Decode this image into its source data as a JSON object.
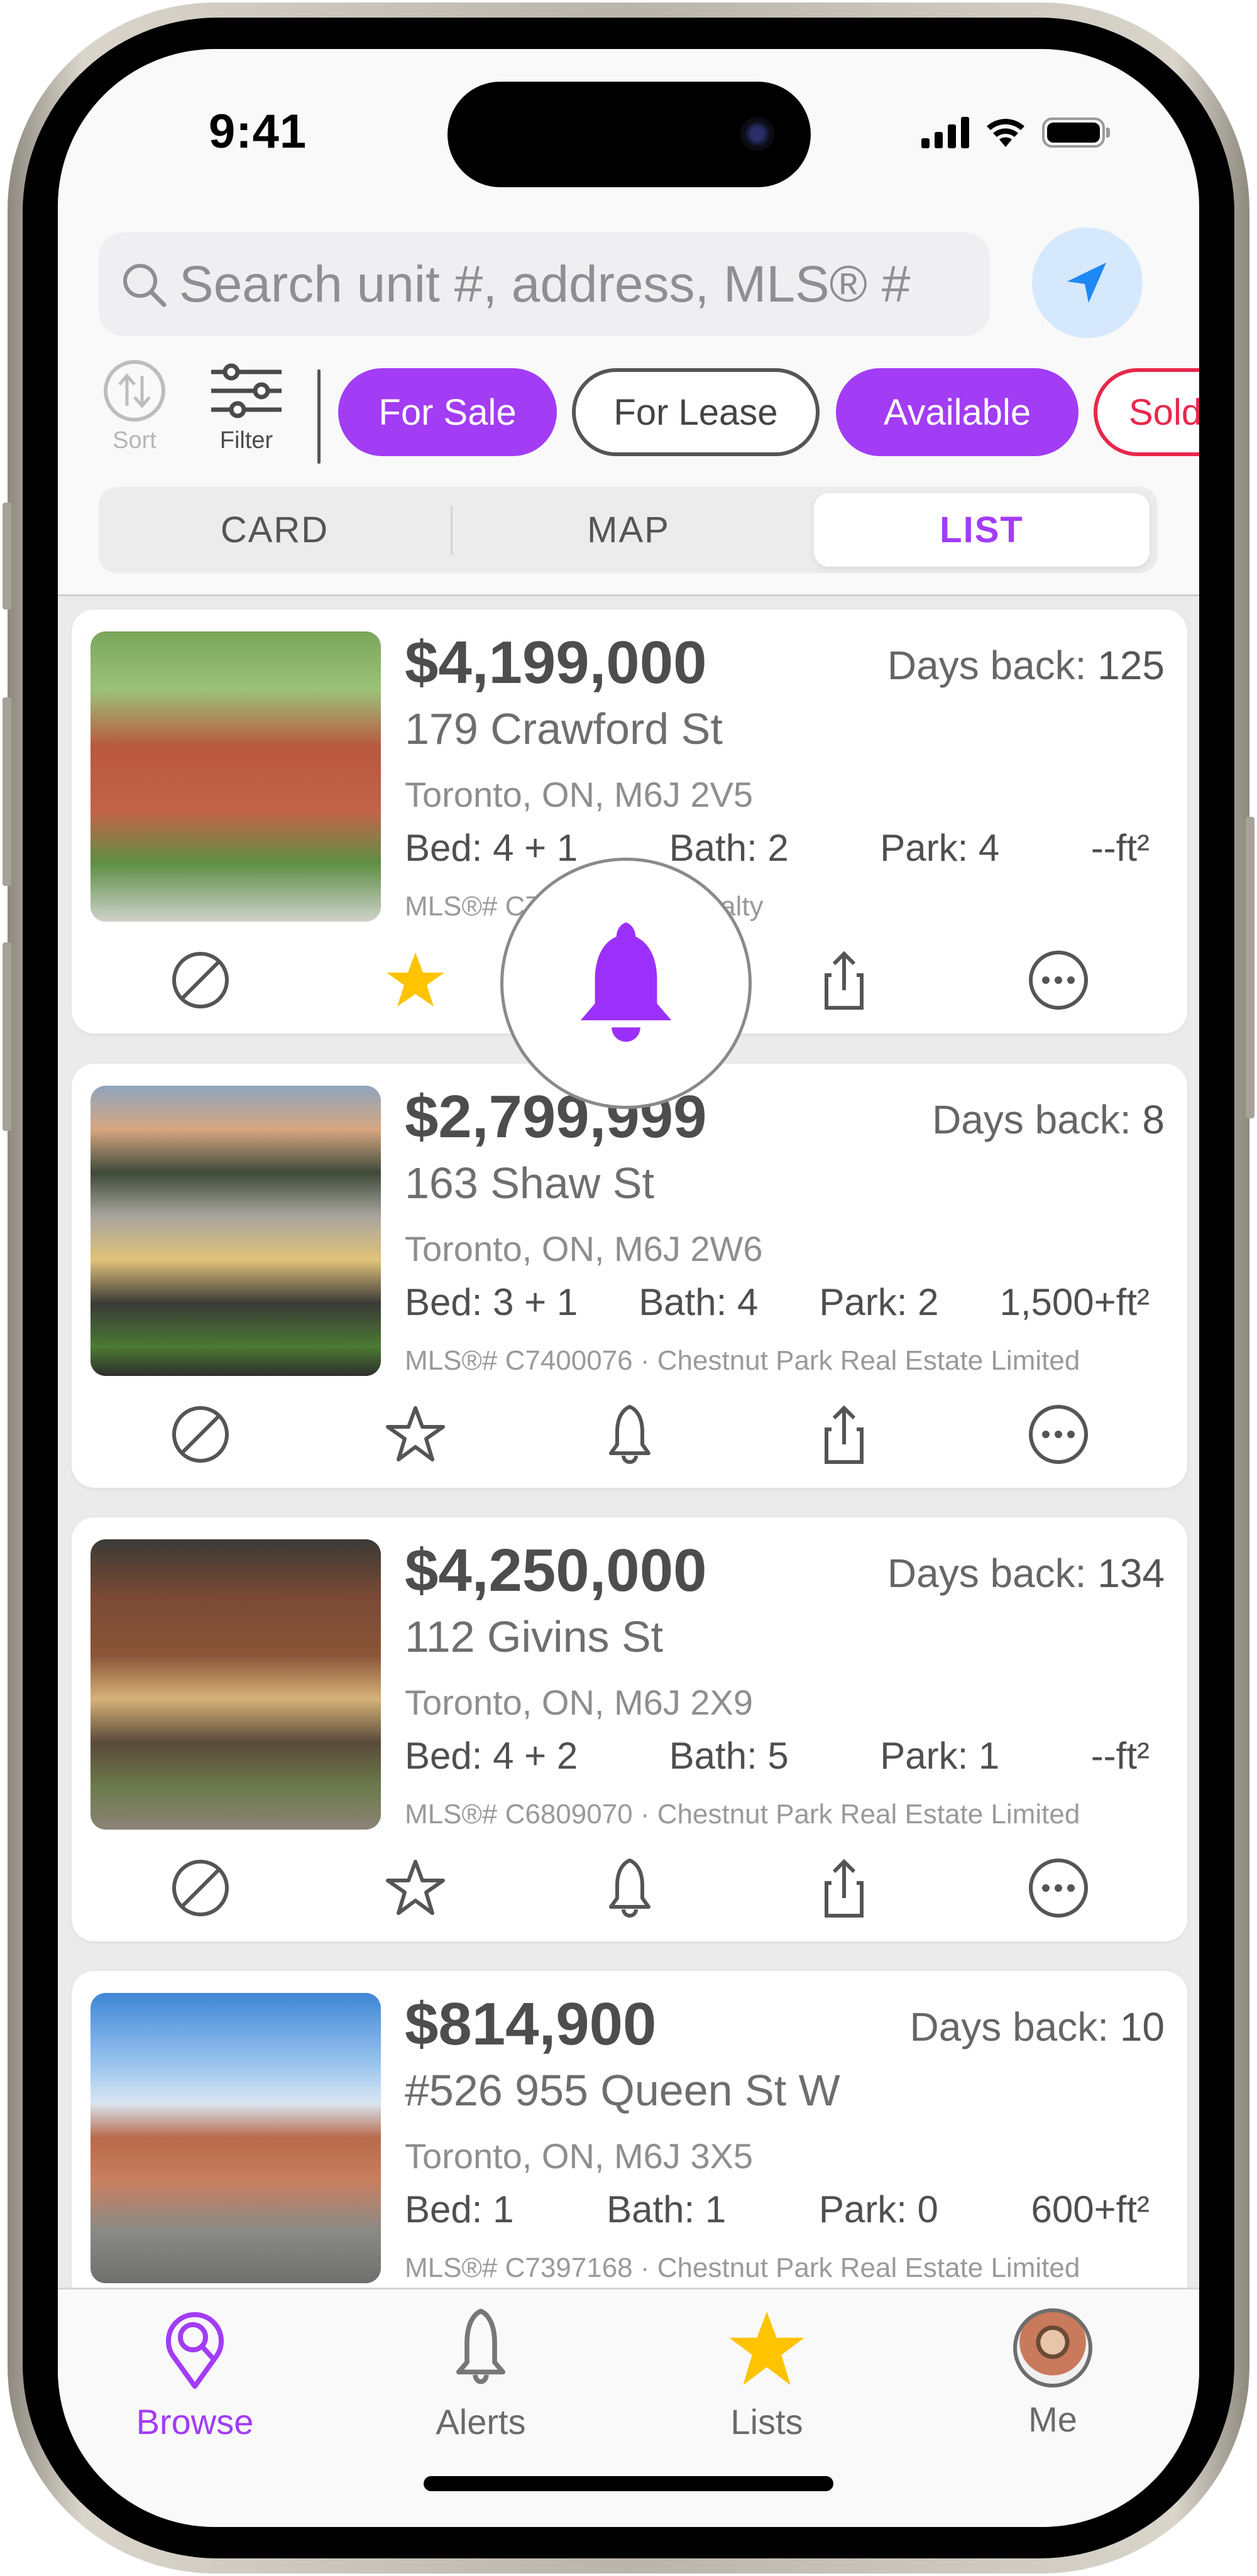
{
  "status_bar": {
    "time": "9:41"
  },
  "search": {
    "placeholder": "Search unit #, address, MLS® #",
    "value": ""
  },
  "toolbar": {
    "sort_label": "Sort",
    "filter_label": "Filter",
    "chips": [
      {
        "label": "For Sale",
        "state": "selected"
      },
      {
        "label": "For Lease",
        "state": "unselected"
      },
      {
        "label": "Available",
        "state": "selected"
      },
      {
        "label": "Sold",
        "state": "unselected"
      }
    ]
  },
  "view_tabs": [
    {
      "label": "CARD",
      "active": false
    },
    {
      "label": "MAP",
      "active": false
    },
    {
      "label": "LIST",
      "active": true
    }
  ],
  "listings": [
    {
      "price": "$4,199,000",
      "days_back_label": "Days back:",
      "days_back": "125",
      "address": "179 Crawford St",
      "city": "Toronto, ON, M6J 2V5",
      "bed": "Bed: 4 + 1",
      "bath": "Bath: 2",
      "park": "Park: 4",
      "sqft": "--ft²",
      "mls_line": "MLS®# C7",
      "mls_tail": "Realty",
      "favorited": true,
      "alert_on": true
    },
    {
      "price": "$2,799,999",
      "days_back_label": "Days back:",
      "days_back": "8",
      "address": "163 Shaw St",
      "city": "Toronto, ON, M6J 2W6",
      "bed": "Bed: 3 + 1",
      "bath": "Bath: 4",
      "park": "Park: 2",
      "sqft": "1,500+ft²",
      "mls_line": "MLS®# C7400076 · Chestnut Park Real Estate Limited",
      "favorited": false,
      "alert_on": false
    },
    {
      "price": "$4,250,000",
      "days_back_label": "Days back:",
      "days_back": "134",
      "address": "112 Givins St",
      "city": "Toronto, ON, M6J 2X9",
      "bed": "Bed: 4 + 2",
      "bath": "Bath: 5",
      "park": "Park: 1",
      "sqft": "--ft²",
      "mls_line": "MLS®# C6809070 · Chestnut Park Real Estate Limited",
      "favorited": false,
      "alert_on": false
    },
    {
      "price": "$814,900",
      "days_back_label": "Days back:",
      "days_back": "10",
      "address": "#526 955 Queen St W",
      "city": "Toronto, ON, M6J 3X5",
      "bed": "Bed: 1",
      "bath": "Bath: 1",
      "park": "Park: 0",
      "sqft": "600+ft²",
      "mls_line": "MLS®# C7397168 · Chestnut Park Real Estate Limited",
      "favorited": false,
      "alert_on": false
    }
  ],
  "card_actions": [
    "hide-icon",
    "favorite-star-icon",
    "alert-bell-icon",
    "share-icon",
    "more-icon"
  ],
  "tab_bar": [
    {
      "label": "Browse",
      "icon": "browse-pin-search-icon",
      "active": true
    },
    {
      "label": "Alerts",
      "icon": "bell-icon",
      "active": false
    },
    {
      "label": "Lists",
      "icon": "star-icon",
      "active": false
    },
    {
      "label": "Me",
      "icon": "avatar",
      "active": false
    }
  ],
  "colors": {
    "accent": "#a23cf5",
    "favorite": "#ffc300",
    "sold": "#e8274b",
    "locate_bg": "#d6e8fb",
    "locate_icon": "#1e88f5"
  }
}
